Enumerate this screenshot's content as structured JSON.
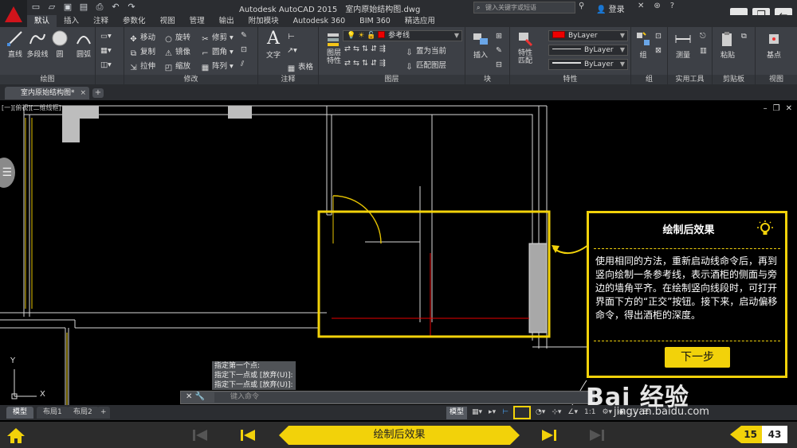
{
  "window": {
    "app_title": "Autodesk AutoCAD 2015",
    "doc_title": "室内原始结构图.dwg",
    "search_placeholder": "键入关键字或短语",
    "login": "登录"
  },
  "ribbon_tabs": [
    "默认",
    "插入",
    "注释",
    "参数化",
    "视图",
    "管理",
    "输出",
    "附加模块",
    "Autodesk 360",
    "BIM 360",
    "精选应用"
  ],
  "panels": {
    "draw": {
      "title": "绘图",
      "line": "直线",
      "polyline": "多段线",
      "circle": "圆",
      "arc": "圆弧"
    },
    "modify": {
      "title": "修改",
      "move": "移动",
      "rotate": "旋转",
      "trim": "修剪",
      "copy": "复制",
      "mirror": "镜像",
      "fillet": "圆角",
      "stretch": "拉伸",
      "scale": "缩放",
      "array": "阵列"
    },
    "annotation": {
      "title": "注释",
      "text": "文字",
      "dimension": "标注",
      "table": "表格"
    },
    "layers": {
      "title": "图层",
      "layer_props": "图层\n特性",
      "current_layer": "参考线",
      "set_current": "置为当前",
      "match_layer": "匹配图层"
    },
    "block": {
      "title": "块",
      "insert": "插入"
    },
    "properties": {
      "title": "特性",
      "match_props": "特性\n匹配",
      "color": "ByLayer",
      "linetype": "ByLayer",
      "lineweight": "ByLayer"
    },
    "groups": {
      "title": "组",
      "group": "组"
    },
    "utilities": {
      "title": "实用工具",
      "measure": "测量"
    },
    "clipboard": {
      "title": "剪贴板",
      "paste": "粘贴"
    },
    "view": {
      "title": "视图",
      "base": "基点"
    }
  },
  "document_tab": "室内原始结构图*",
  "viewport_label": "[一][俯视][二维线框]",
  "callout": {
    "title": "绘制后效果",
    "body": "使用相同的方法，重新启动线命令后，再到竖向绘制一条参考线，表示酒柜的侧面与旁边的墙角平齐。在绘制竖向线段时，可打开界面下方的“正交”按钮。接下来，启动偏移命令，得出酒柜的深度。",
    "next_button": "下一步"
  },
  "command_history": [
    "指定第一个点:",
    "指定下一点或 [放弃(U)]:",
    "指定下一点或 [放弃(U)]:"
  ],
  "command_placeholder": "键入命令",
  "layout_tabs": [
    "模型",
    "布局1",
    "布局2"
  ],
  "status": {
    "model": "模型",
    "scale": "1:1"
  },
  "tutorial": {
    "step_title": "绘制后效果",
    "current_page": "15",
    "total_pages": "43"
  },
  "watermark": {
    "brand": "Bai 经验",
    "url": "jingyan.baidu.com"
  },
  "colors": {
    "accent_yellow": "#f2d20a",
    "ribbon_bg": "#3d4046",
    "layer_red": "#e00000"
  }
}
